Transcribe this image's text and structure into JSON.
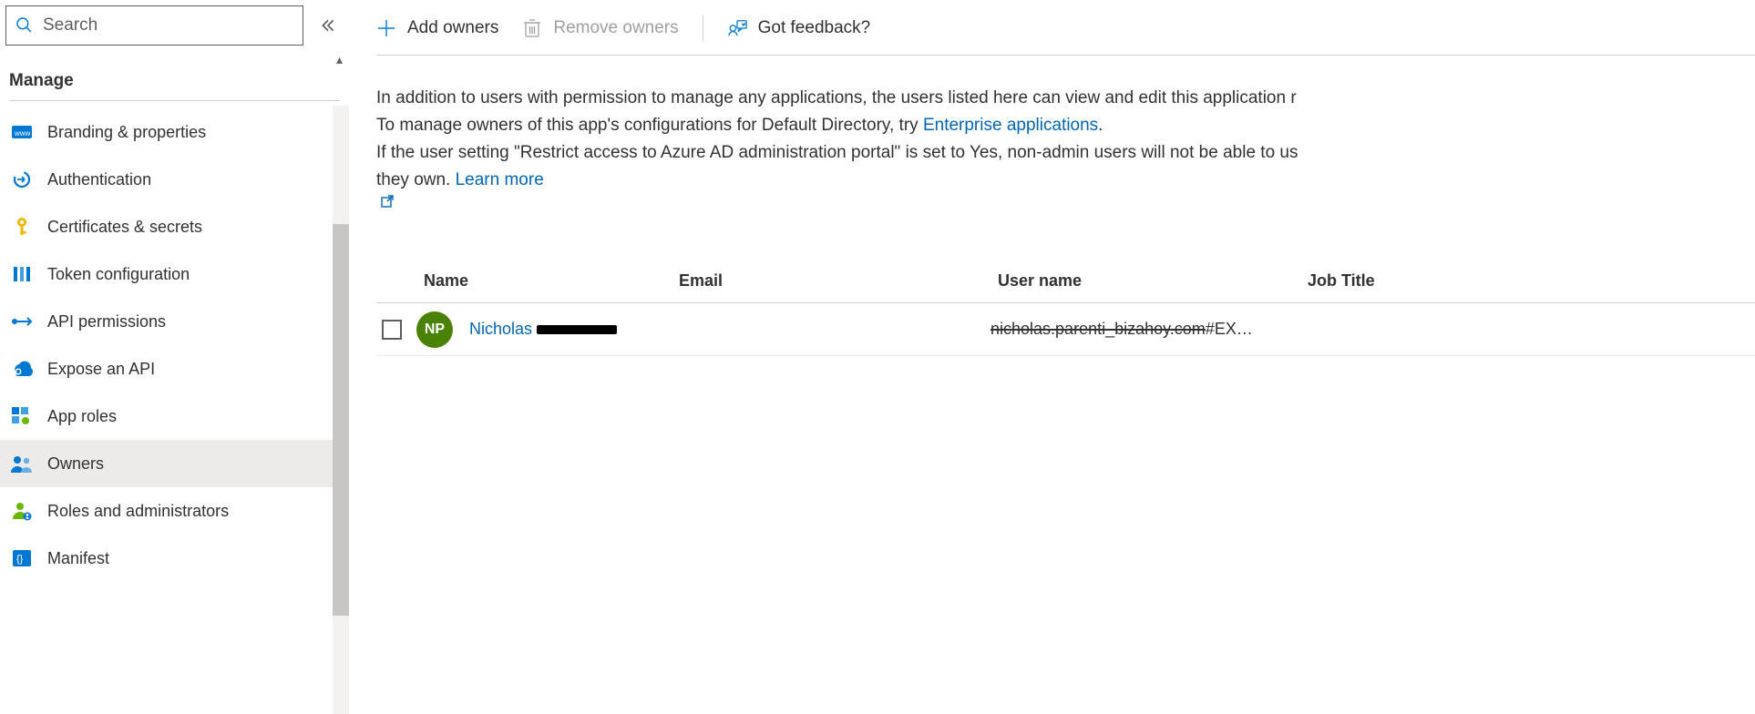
{
  "search": {
    "placeholder": "Search"
  },
  "sidebar": {
    "section": "Manage",
    "items": [
      {
        "label": "Branding & properties",
        "icon": "branding-icon"
      },
      {
        "label": "Authentication",
        "icon": "auth-icon"
      },
      {
        "label": "Certificates & secrets",
        "icon": "key-icon"
      },
      {
        "label": "Token configuration",
        "icon": "token-icon"
      },
      {
        "label": "API permissions",
        "icon": "api-perm-icon"
      },
      {
        "label": "Expose an API",
        "icon": "expose-api-icon"
      },
      {
        "label": "App roles",
        "icon": "app-roles-icon"
      },
      {
        "label": "Owners",
        "icon": "owners-icon",
        "active": true
      },
      {
        "label": "Roles and administrators",
        "icon": "roles-admin-icon"
      },
      {
        "label": "Manifest",
        "icon": "manifest-icon"
      }
    ]
  },
  "toolbar": {
    "add": "Add owners",
    "remove": "Remove owners",
    "feedback": "Got feedback?"
  },
  "description": {
    "line1": "In addition to users with permission to manage any applications, the users listed here can view and edit this application r",
    "line2_a": "To manage owners of this app's configurations for Default Directory, try ",
    "line2_link": "Enterprise applications",
    "line2_b": ".",
    "line3_a": "If the user setting \"Restrict access to Azure AD administration portal\" is set to Yes, non-admin users will not be able to us",
    "line4_a": "they own.  ",
    "learn_more": "Learn more"
  },
  "table": {
    "headers": {
      "name": "Name",
      "email": "Email",
      "user": "User name",
      "job": "Job Title"
    },
    "rows": [
      {
        "initials": "NP",
        "name_visible": "Nicholas",
        "email": "",
        "username_redacted": "nicholas.parenti_bizahoy.com",
        "username_suffix": "#EX…",
        "job": ""
      }
    ]
  }
}
